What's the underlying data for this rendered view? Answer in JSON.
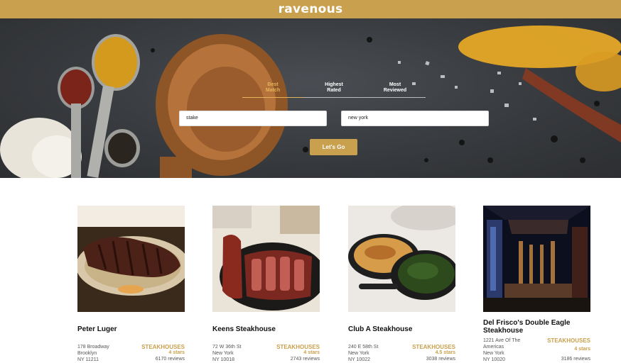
{
  "app": {
    "logo": "ravenous"
  },
  "search": {
    "sort_options": [
      {
        "line1": "Best",
        "line2": "Match",
        "active": true
      },
      {
        "line1": "Highest",
        "line2": "Rated",
        "active": false
      },
      {
        "line1": "Most",
        "line2": "Reviewed",
        "active": false
      }
    ],
    "term_value": "stake",
    "location_value": "new york",
    "submit_label": "Let's Go"
  },
  "businesses": [
    {
      "name": "Peter Luger",
      "address": "178 Broadway",
      "city": "Brooklyn",
      "state_zip": "NY 11211",
      "category": "STEAKHOUSES",
      "rating": "4 stars",
      "reviews": "6170 reviews"
    },
    {
      "name": "Keens Steakhouse",
      "address": "72 W 36th St",
      "city": "New York",
      "state_zip": "NY 10018",
      "category": "STEAKHOUSES",
      "rating": "4 stars",
      "reviews": "2743 reviews"
    },
    {
      "name": "Club A Steakhouse",
      "address": "240 E 58th St",
      "city": "New York",
      "state_zip": "NY 10022",
      "category": "STEAKHOUSES",
      "rating": "4.5 stars",
      "reviews": "3038 reviews"
    },
    {
      "name": "Del Frisco's Double Eagle Steakhouse",
      "address": "1221 Ave Of The Americas",
      "city": "New York",
      "state_zip": "NY 10020",
      "category": "STEAKHOUSES",
      "rating": "4 stars",
      "reviews": "3186 reviews"
    }
  ],
  "colors": {
    "accent": "#c9a04d",
    "hero_bg": "#3a3d41"
  }
}
